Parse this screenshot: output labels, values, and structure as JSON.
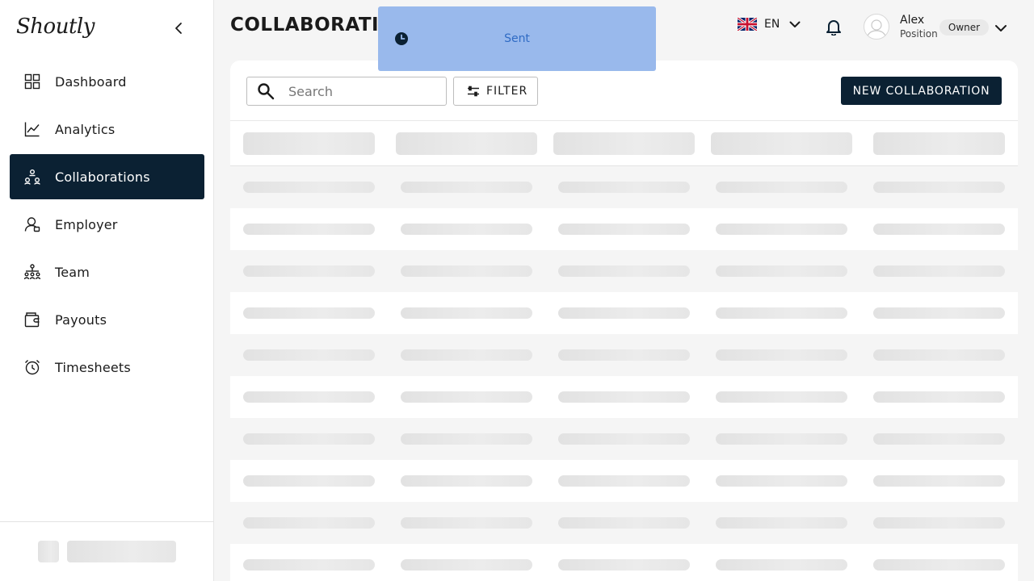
{
  "app": {
    "logo_text": "Shoutly"
  },
  "sidebar": {
    "items": [
      {
        "label": "Dashboard",
        "icon": "dashboard-icon",
        "active": false
      },
      {
        "label": "Analytics",
        "icon": "analytics-icon",
        "active": false
      },
      {
        "label": "Collaborations",
        "icon": "collaborations-icon",
        "active": true
      },
      {
        "label": "Employer",
        "icon": "employer-icon",
        "active": false
      },
      {
        "label": "Team",
        "icon": "team-icon",
        "active": false
      },
      {
        "label": "Payouts",
        "icon": "payouts-icon",
        "active": false
      },
      {
        "label": "Timesheets",
        "icon": "timesheets-icon",
        "active": false
      }
    ]
  },
  "header": {
    "title": "COLLABORATIO",
    "language": {
      "code": "EN",
      "flag": "uk-flag-icon"
    },
    "user": {
      "name": "Alex",
      "position": "Position",
      "role": "Owner"
    }
  },
  "toast": {
    "message": "Sent",
    "icon": "clock-icon"
  },
  "toolbar": {
    "search_placeholder": "Search",
    "filter_label": "FILTER",
    "new_button_label": "NEW COLLABORATION"
  },
  "colors": {
    "primary": "#0b2133",
    "toast_bg": "#99b9ec",
    "toast_text": "#2f6bc4",
    "background": "#f5f5f5"
  },
  "table": {
    "loading": true,
    "skeleton_rows": 10,
    "columns": 5
  }
}
